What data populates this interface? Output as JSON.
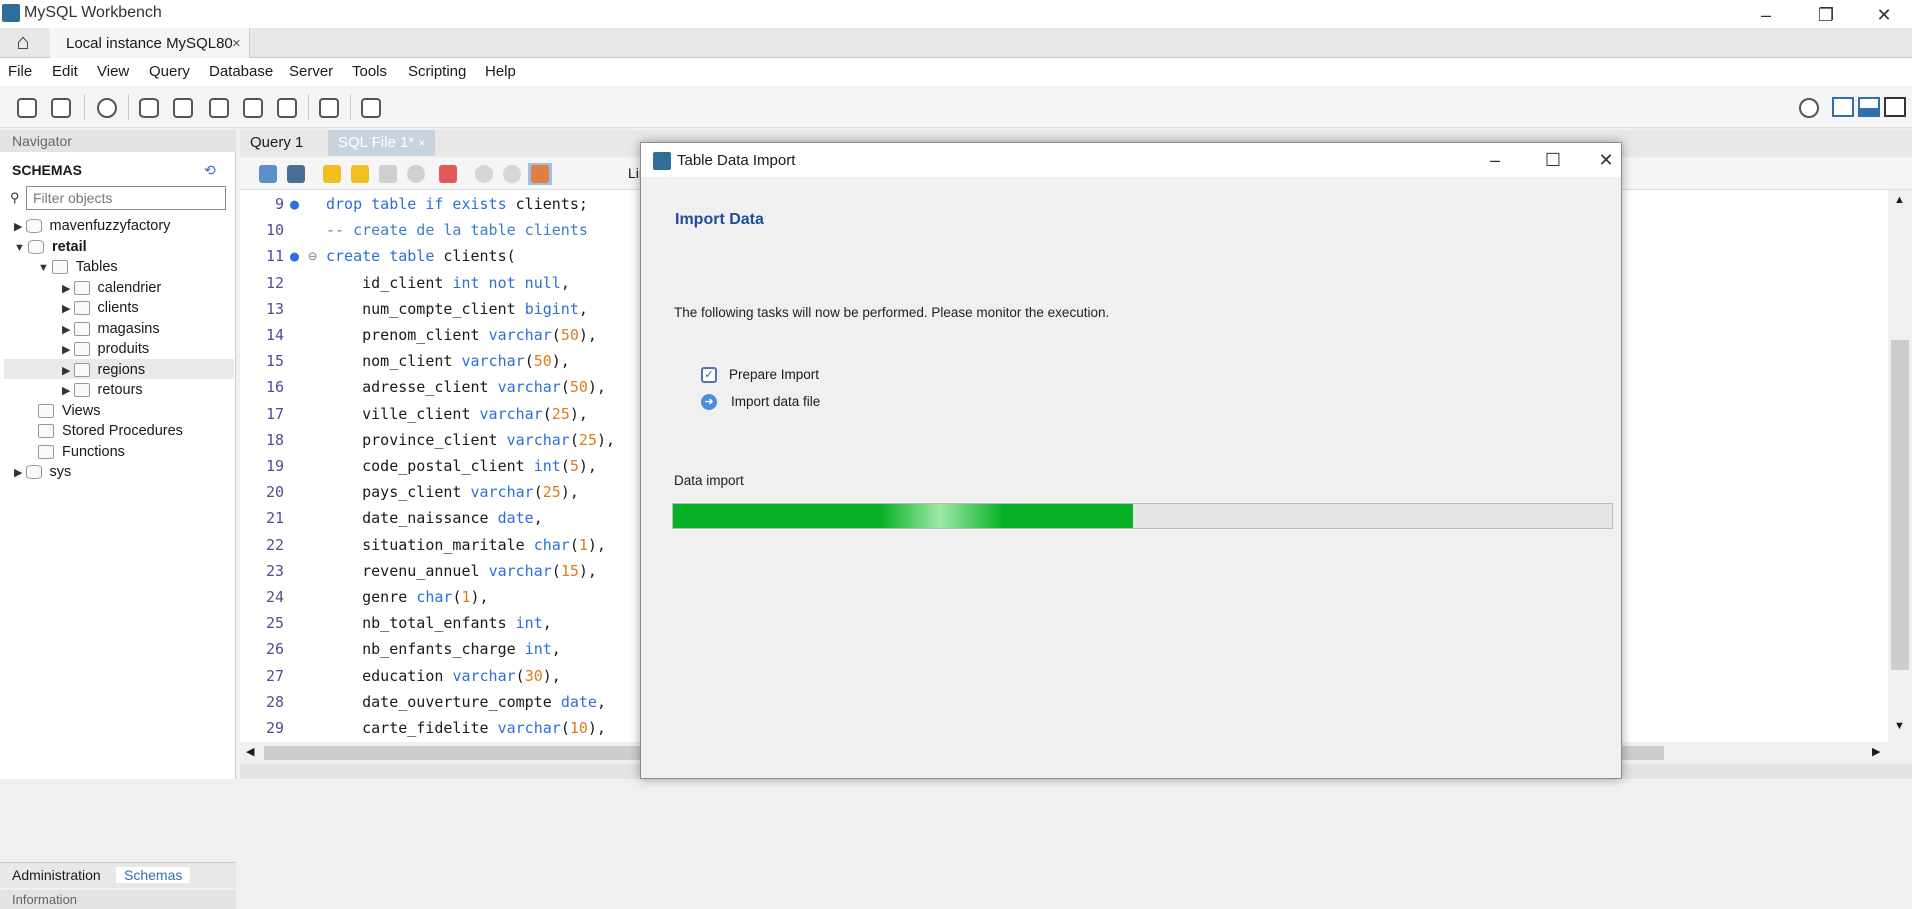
{
  "app": {
    "title": "MySQL Workbench",
    "connection_tab": "Local instance MySQL80",
    "window_controls": [
      "minimize",
      "restore",
      "close"
    ]
  },
  "menu": [
    "File",
    "Edit",
    "View",
    "Query",
    "Database",
    "Server",
    "Tools",
    "Scripting",
    "Help"
  ],
  "navigator": {
    "header": "Navigator",
    "schemas_label": "SCHEMAS",
    "filter_placeholder": "Filter objects",
    "tree": [
      {
        "label": "mavenfuzzyfactory",
        "level": 0,
        "expanded": false,
        "bold": false
      },
      {
        "label": "retail",
        "level": 0,
        "expanded": true,
        "bold": true
      },
      {
        "label": "Tables",
        "level": 1,
        "expanded": true,
        "bold": false
      },
      {
        "label": "calendrier",
        "level": 2,
        "expanded": false,
        "bold": false
      },
      {
        "label": "clients",
        "level": 2,
        "expanded": false,
        "bold": false
      },
      {
        "label": "magasins",
        "level": 2,
        "expanded": false,
        "bold": false
      },
      {
        "label": "produits",
        "level": 2,
        "expanded": false,
        "bold": false
      },
      {
        "label": "regions",
        "level": 2,
        "expanded": false,
        "bold": false,
        "selected": true
      },
      {
        "label": "retours",
        "level": 2,
        "expanded": false,
        "bold": false
      },
      {
        "label": "Views",
        "level": 1,
        "expanded": null,
        "bold": false
      },
      {
        "label": "Stored Procedures",
        "level": 1,
        "expanded": null,
        "bold": false
      },
      {
        "label": "Functions",
        "level": 1,
        "expanded": null,
        "bold": false
      },
      {
        "label": "sys",
        "level": 0,
        "expanded": false,
        "bold": false
      }
    ],
    "bottom_tabs": [
      "Administration",
      "Schemas"
    ],
    "info_label": "Information"
  },
  "editor": {
    "tabs": [
      "Query 1",
      "SQL File 1*"
    ],
    "toolbar_partial_label": "Lin",
    "lines": [
      {
        "n": "9",
        "dot": true,
        "fold": false,
        "text": [
          [
            "kw",
            "drop table if exists"
          ],
          [
            "p",
            " clients;"
          ]
        ]
      },
      {
        "n": "10",
        "dot": false,
        "fold": false,
        "text": [
          [
            "cmt",
            "-- create de la table clients"
          ]
        ]
      },
      {
        "n": "11",
        "dot": true,
        "fold": true,
        "text": [
          [
            "kw",
            "create table"
          ],
          [
            "p",
            " clients("
          ]
        ]
      },
      {
        "n": "12",
        "dot": false,
        "fold": false,
        "text": [
          [
            "p",
            "    id_client "
          ],
          [
            "kw",
            "int not null"
          ],
          [
            "p",
            ","
          ]
        ]
      },
      {
        "n": "13",
        "dot": false,
        "fold": false,
        "text": [
          [
            "p",
            "    num_compte_client "
          ],
          [
            "kw",
            "bigint"
          ],
          [
            "p",
            ","
          ]
        ]
      },
      {
        "n": "14",
        "dot": false,
        "fold": false,
        "text": [
          [
            "p",
            "    prenom_client "
          ],
          [
            "kw",
            "varchar"
          ],
          [
            "p",
            "("
          ],
          [
            "num",
            "50"
          ],
          [
            "p",
            "),"
          ]
        ]
      },
      {
        "n": "15",
        "dot": false,
        "fold": false,
        "text": [
          [
            "p",
            "    nom_client "
          ],
          [
            "kw",
            "varchar"
          ],
          [
            "p",
            "("
          ],
          [
            "num",
            "50"
          ],
          [
            "p",
            "),"
          ]
        ]
      },
      {
        "n": "16",
        "dot": false,
        "fold": false,
        "text": [
          [
            "p",
            "    adresse_client "
          ],
          [
            "kw",
            "varchar"
          ],
          [
            "p",
            "("
          ],
          [
            "num",
            "50"
          ],
          [
            "p",
            "),"
          ]
        ]
      },
      {
        "n": "17",
        "dot": false,
        "fold": false,
        "text": [
          [
            "p",
            "    ville_client "
          ],
          [
            "kw",
            "varchar"
          ],
          [
            "p",
            "("
          ],
          [
            "num",
            "25"
          ],
          [
            "p",
            "),"
          ]
        ]
      },
      {
        "n": "18",
        "dot": false,
        "fold": false,
        "text": [
          [
            "p",
            "    province_client "
          ],
          [
            "kw",
            "varchar"
          ],
          [
            "p",
            "("
          ],
          [
            "num",
            "25"
          ],
          [
            "p",
            "),"
          ]
        ]
      },
      {
        "n": "19",
        "dot": false,
        "fold": false,
        "text": [
          [
            "p",
            "    code_postal_client "
          ],
          [
            "kw",
            "int"
          ],
          [
            "p",
            "("
          ],
          [
            "num",
            "5"
          ],
          [
            "p",
            "),"
          ]
        ]
      },
      {
        "n": "20",
        "dot": false,
        "fold": false,
        "text": [
          [
            "p",
            "    pays_client "
          ],
          [
            "kw",
            "varchar"
          ],
          [
            "p",
            "("
          ],
          [
            "num",
            "25"
          ],
          [
            "p",
            "),"
          ]
        ]
      },
      {
        "n": "21",
        "dot": false,
        "fold": false,
        "text": [
          [
            "p",
            "    date_naissance "
          ],
          [
            "kw",
            "date"
          ],
          [
            "p",
            ","
          ]
        ]
      },
      {
        "n": "22",
        "dot": false,
        "fold": false,
        "text": [
          [
            "p",
            "    situation_maritale "
          ],
          [
            "kw",
            "char"
          ],
          [
            "p",
            "("
          ],
          [
            "num",
            "1"
          ],
          [
            "p",
            "),"
          ]
        ]
      },
      {
        "n": "23",
        "dot": false,
        "fold": false,
        "text": [
          [
            "p",
            "    revenu_annuel "
          ],
          [
            "kw",
            "varchar"
          ],
          [
            "p",
            "("
          ],
          [
            "num",
            "15"
          ],
          [
            "p",
            "),"
          ]
        ]
      },
      {
        "n": "24",
        "dot": false,
        "fold": false,
        "text": [
          [
            "p",
            "    genre "
          ],
          [
            "kw",
            "char"
          ],
          [
            "p",
            "("
          ],
          [
            "num",
            "1"
          ],
          [
            "p",
            "),"
          ]
        ]
      },
      {
        "n": "25",
        "dot": false,
        "fold": false,
        "text": [
          [
            "p",
            "    nb_total_enfants "
          ],
          [
            "kw",
            "int"
          ],
          [
            "p",
            ","
          ]
        ]
      },
      {
        "n": "26",
        "dot": false,
        "fold": false,
        "text": [
          [
            "p",
            "    nb_enfants_charge "
          ],
          [
            "kw",
            "int"
          ],
          [
            "p",
            ","
          ]
        ]
      },
      {
        "n": "27",
        "dot": false,
        "fold": false,
        "text": [
          [
            "p",
            "    education "
          ],
          [
            "kw",
            "varchar"
          ],
          [
            "p",
            "("
          ],
          [
            "num",
            "30"
          ],
          [
            "p",
            "),"
          ]
        ]
      },
      {
        "n": "28",
        "dot": false,
        "fold": false,
        "text": [
          [
            "p",
            "    date_ouverture_compte "
          ],
          [
            "kw",
            "date"
          ],
          [
            "p",
            ","
          ]
        ]
      },
      {
        "n": "29",
        "dot": false,
        "fold": false,
        "text": [
          [
            "p",
            "    carte_fidelite "
          ],
          [
            "kw",
            "varchar"
          ],
          [
            "p",
            "("
          ],
          [
            "num",
            "10"
          ],
          [
            "p",
            "),"
          ]
        ]
      }
    ]
  },
  "dialog": {
    "title": "Table Data Import",
    "heading": "Import Data",
    "description": "The following tasks will now be performed. Please monitor the execution.",
    "tasks": [
      {
        "label": "Prepare Import",
        "status": "done"
      },
      {
        "label": "Import data file",
        "status": "running"
      }
    ],
    "progress_label": "Data import",
    "progress_fraction": 0.49
  },
  "colors": {
    "keyword": "#2a6fdb",
    "number": "#e07b1a",
    "progress": "#06b025",
    "heading": "#1f4e94"
  }
}
